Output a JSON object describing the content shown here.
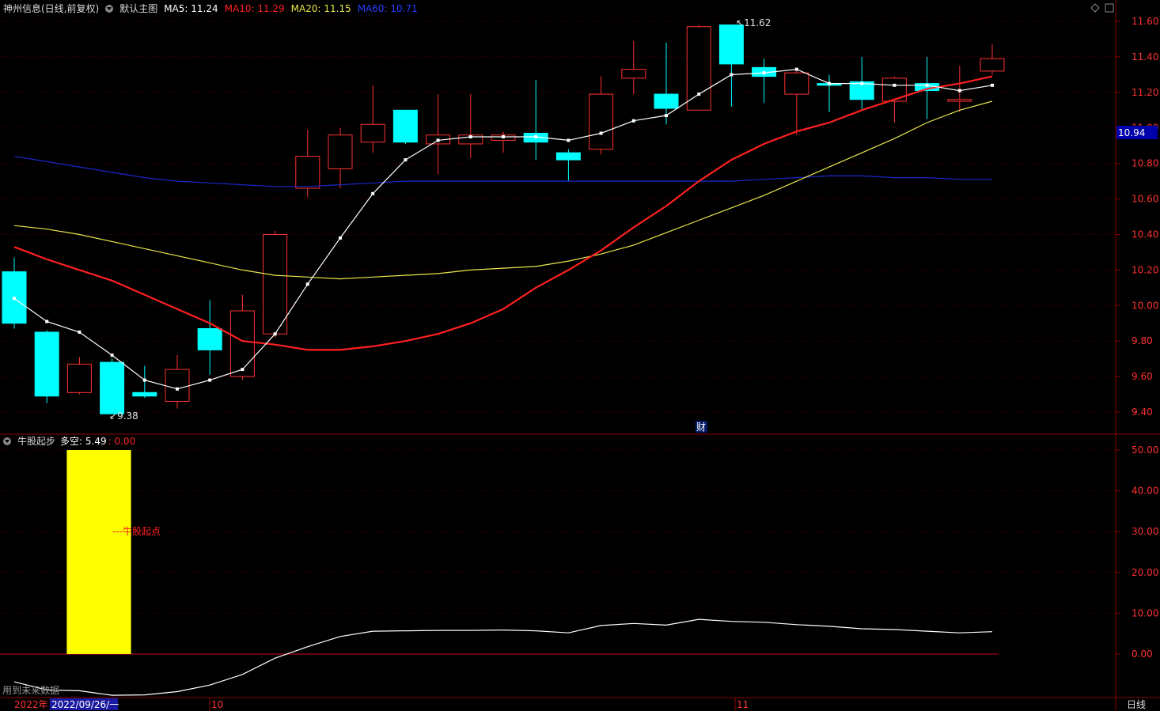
{
  "header": {
    "stock_name": "神州信息(日线,前复权)",
    "main_chart_label": "默认主图",
    "ma5": "MA5: 11.24",
    "ma10": "MA10: 11.29",
    "ma20": "MA20: 11.15",
    "ma60": "MA60: 10.71"
  },
  "indicator_header": {
    "name": "牛股起步",
    "duokong": "多空: 5.49",
    "value2": ": 0.00"
  },
  "annotations": {
    "high_label": "11.62",
    "low_label": "9.38",
    "cai_marker": "财",
    "bull_start": "---牛股起点",
    "future_data_note": "用到未来数据"
  },
  "current_price": "10.94",
  "footer": {
    "year": "2022年",
    "date": "2022/09/26/一",
    "month_10": "10",
    "month_11": "11",
    "period": "日线"
  },
  "colors": {
    "up": "#ff3232",
    "down": "#00ffff",
    "ma5": "#ffffff",
    "ma10": "#ff2020",
    "ma20": "#e6e64c",
    "ma60": "#1a28c8",
    "bull_bar": "#ffff00",
    "border": "#8b0000"
  },
  "chart_data": [
    {
      "type": "candlestick",
      "title": "神州信息(日线,前复权)",
      "ylim": [
        9.3,
        11.7
      ],
      "yticks": [
        "11.60",
        "11.40",
        "11.20",
        "11.00",
        "10.80",
        "10.60",
        "10.40",
        "10.20",
        "10.00",
        "9.80",
        "9.60",
        "9.40"
      ],
      "ytick_values": [
        11.6,
        11.4,
        11.2,
        11.0,
        10.8,
        10.6,
        10.4,
        10.2,
        10.0,
        9.8,
        9.6,
        9.4
      ],
      "candles": [
        {
          "o": 10.19,
          "h": 10.27,
          "l": 9.87,
          "c": 9.9
        },
        {
          "o": 9.85,
          "h": 9.86,
          "l": 9.45,
          "c": 9.49
        },
        {
          "o": 9.51,
          "h": 9.71,
          "l": 9.5,
          "c": 9.67
        },
        {
          "o": 9.68,
          "h": 9.7,
          "l": 9.39,
          "c": 9.39
        },
        {
          "o": 9.51,
          "h": 9.66,
          "l": 9.48,
          "c": 9.49
        },
        {
          "o": 9.46,
          "h": 9.72,
          "l": 9.42,
          "c": 9.64
        },
        {
          "o": 9.87,
          "h": 10.03,
          "l": 9.61,
          "c": 9.75
        },
        {
          "o": 9.6,
          "h": 10.06,
          "l": 9.58,
          "c": 9.97
        },
        {
          "o": 9.84,
          "h": 10.42,
          "l": 9.82,
          "c": 10.4
        },
        {
          "o": 10.66,
          "h": 10.99,
          "l": 10.61,
          "c": 10.84
        },
        {
          "o": 10.77,
          "h": 11.0,
          "l": 10.66,
          "c": 10.96
        },
        {
          "o": 10.92,
          "h": 11.24,
          "l": 10.86,
          "c": 11.02
        },
        {
          "o": 11.1,
          "h": 11.1,
          "l": 10.91,
          "c": 10.92
        },
        {
          "o": 10.91,
          "h": 11.19,
          "l": 10.74,
          "c": 10.96
        },
        {
          "o": 10.91,
          "h": 11.19,
          "l": 10.83,
          "c": 10.96
        },
        {
          "o": 10.93,
          "h": 10.98,
          "l": 10.86,
          "c": 10.96
        },
        {
          "o": 10.97,
          "h": 11.27,
          "l": 10.82,
          "c": 10.92
        },
        {
          "o": 10.86,
          "h": 10.88,
          "l": 10.7,
          "c": 10.82
        },
        {
          "o": 10.88,
          "h": 11.29,
          "l": 10.85,
          "c": 11.19
        },
        {
          "o": 11.28,
          "h": 11.49,
          "l": 11.19,
          "c": 11.33
        },
        {
          "o": 11.19,
          "h": 11.48,
          "l": 11.02,
          "c": 11.11
        },
        {
          "o": 11.1,
          "h": 11.58,
          "l": 11.1,
          "c": 11.57
        },
        {
          "o": 11.58,
          "h": 11.58,
          "l": 11.12,
          "c": 11.36
        },
        {
          "o": 11.34,
          "h": 11.39,
          "l": 11.14,
          "c": 11.29
        },
        {
          "o": 11.19,
          "h": 11.32,
          "l": 10.96,
          "c": 11.31
        },
        {
          "o": 11.25,
          "h": 11.3,
          "l": 11.09,
          "c": 11.24
        },
        {
          "o": 11.26,
          "h": 11.4,
          "l": 11.1,
          "c": 11.16
        },
        {
          "o": 11.15,
          "h": 11.29,
          "l": 11.03,
          "c": 11.28
        },
        {
          "o": 11.25,
          "h": 11.4,
          "l": 11.05,
          "c": 11.21
        },
        {
          "o": 11.15,
          "h": 11.35,
          "l": 11.09,
          "c": 11.16
        },
        {
          "o": 11.32,
          "h": 11.47,
          "l": 11.3,
          "c": 11.39
        }
      ],
      "ma5": [
        10.04,
        9.91,
        9.85,
        9.72,
        9.58,
        9.53,
        9.58,
        9.64,
        9.84,
        10.12,
        10.38,
        10.63,
        10.82,
        10.93,
        10.95,
        10.95,
        10.95,
        10.93,
        10.97,
        11.04,
        11.07,
        11.19,
        11.3,
        11.31,
        11.33,
        11.25,
        11.25,
        11.24,
        11.24,
        11.21,
        11.24
      ],
      "ma10": [
        10.33,
        10.26,
        10.2,
        10.14,
        10.06,
        9.98,
        9.9,
        9.8,
        9.78,
        9.75,
        9.75,
        9.77,
        9.8,
        9.84,
        9.9,
        9.98,
        10.1,
        10.2,
        10.31,
        10.44,
        10.56,
        10.7,
        10.82,
        10.91,
        10.98,
        11.03,
        11.1,
        11.16,
        11.22,
        11.25,
        11.29
      ],
      "ma20": [
        10.45,
        10.43,
        10.4,
        10.36,
        10.32,
        10.28,
        10.24,
        10.2,
        10.17,
        10.16,
        10.15,
        10.16,
        10.17,
        10.18,
        10.2,
        10.21,
        10.22,
        10.25,
        10.29,
        10.34,
        10.41,
        10.48,
        10.55,
        10.62,
        10.7,
        10.78,
        10.86,
        10.94,
        11.03,
        11.1,
        11.15
      ],
      "ma60": [
        10.84,
        10.81,
        10.78,
        10.75,
        10.72,
        10.7,
        10.69,
        10.68,
        10.67,
        10.67,
        10.68,
        10.69,
        10.7,
        10.7,
        10.7,
        10.7,
        10.7,
        10.7,
        10.7,
        10.7,
        10.7,
        10.7,
        10.7,
        10.71,
        10.72,
        10.73,
        10.73,
        10.72,
        10.72,
        10.71,
        10.71
      ]
    },
    {
      "type": "line",
      "title": "牛股起步",
      "ylim": [
        -12,
        52
      ],
      "yticks": [
        "50.00",
        "40.00",
        "30.00",
        "20.00",
        "10.00",
        "0.00"
      ],
      "ytick_values": [
        50,
        40,
        30,
        20,
        10,
        0
      ],
      "bull_bar": {
        "from": 2,
        "to": 3,
        "value": 50
      },
      "duokong": [
        -6.8,
        -8.8,
        -9.0,
        -10.1,
        -10.0,
        -9.2,
        -7.6,
        -5.0,
        -1.0,
        1.8,
        4.3,
        5.6,
        5.7,
        5.8,
        5.8,
        5.9,
        5.7,
        5.2,
        7.0,
        7.5,
        7.1,
        8.5,
        8.0,
        7.8,
        7.2,
        6.8,
        6.2,
        6.0,
        5.6,
        5.2,
        5.49
      ]
    }
  ]
}
